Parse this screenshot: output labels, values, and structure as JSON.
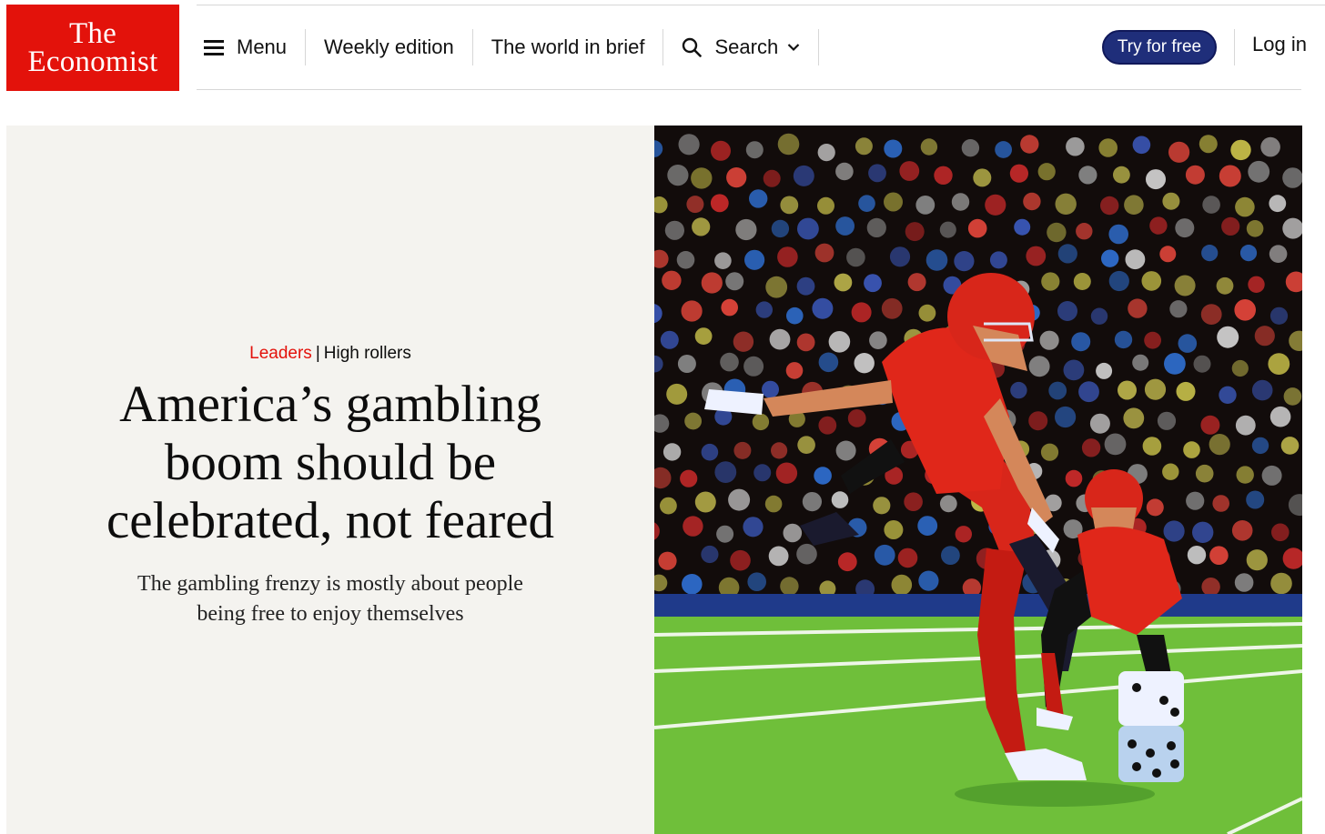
{
  "brand": {
    "line1": "The",
    "line2": "Economist",
    "color": "#e3120b"
  },
  "nav": {
    "menu": "Menu",
    "weekly": "Weekly edition",
    "world": "The world in brief",
    "search": "Search"
  },
  "header": {
    "try_label": "Try for free",
    "login_label": "Log in"
  },
  "article": {
    "section": "Leaders",
    "separator": "|",
    "rubric": "High rollers",
    "headline": "America’s gambling boom should be celebrated, not feared",
    "standfirst": "The gambling frenzy is mostly about people being free to enjoy themselves"
  },
  "colors": {
    "accent": "#e3120b",
    "button": "#1f2e7a",
    "hero_bg": "#f4f3ef"
  }
}
